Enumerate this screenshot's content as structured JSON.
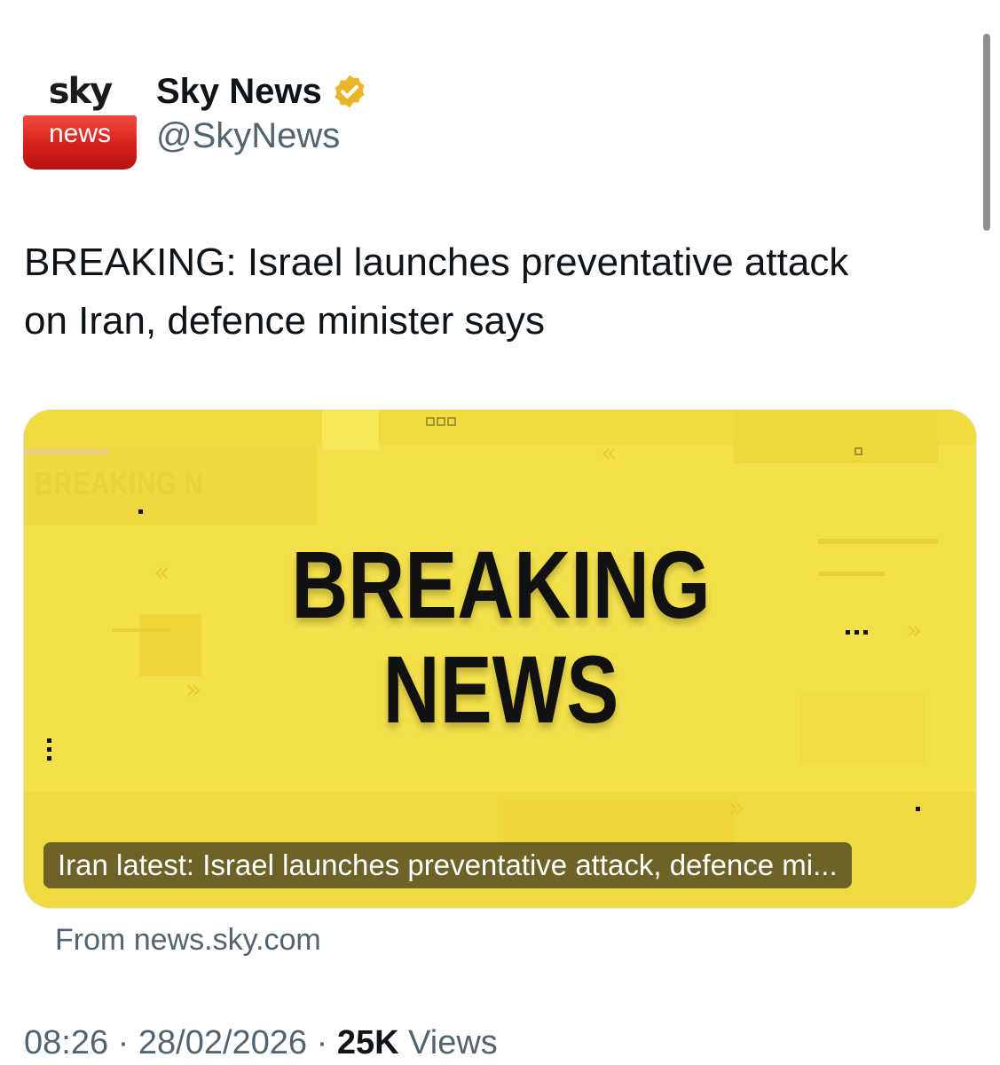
{
  "author": {
    "avatar": {
      "top_word": "sky",
      "bottom_word": "news"
    },
    "display_name": "Sky News",
    "handle": "@SkyNews",
    "verified_badge_color": "#e8b52b"
  },
  "tweet": {
    "line1": "BREAKING: Israel launches preventative attack",
    "line2": "on Iran, defence minister says"
  },
  "card": {
    "headline_line1": "BREAKING",
    "headline_line2": "NEWS",
    "background_label": "BREAKING N",
    "title": "Iran latest: Israel launches preventative attack, defence mi...",
    "source": "From news.sky.com",
    "background_color": "#f4e04a"
  },
  "meta": {
    "time": "08:26",
    "separator": "·",
    "date": "28/02/2026",
    "views_count": "25K",
    "views_label": "Views"
  }
}
